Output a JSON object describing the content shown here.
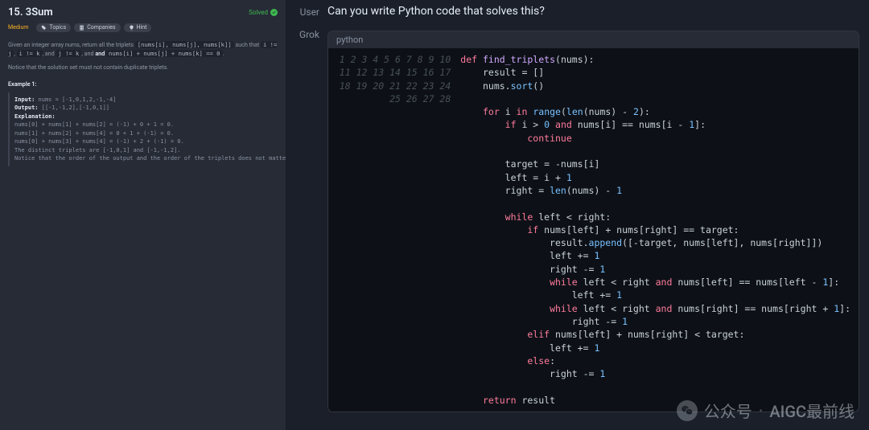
{
  "problem": {
    "title": "15. 3Sum",
    "solved_label": "Solved",
    "difficulty": "Medium",
    "tags": [
      {
        "icon": "tag",
        "label": "Topics"
      },
      {
        "icon": "building",
        "label": "Companies"
      },
      {
        "icon": "lightbulb",
        "label": "Hint"
      }
    ],
    "desc_pre": "Given an integer array nums, return all the triplets ",
    "desc_code1": "[nums[i], nums[j], nums[k]]",
    "desc_mid1": " such that ",
    "desc_code2": "i != j",
    "desc_mid2": ", ",
    "desc_code3": "i != k",
    "desc_mid3": ", and ",
    "desc_code4": "j != k",
    "desc_mid4": ", and ",
    "desc_code5": "nums[i] + nums[j] + nums[k] == 0",
    "desc_post": ".",
    "notice": "Notice that the solution set must not contain duplicate triplets.",
    "example_title": "Example 1:",
    "example": {
      "input_label": "Input:",
      "input": " nums = [-1,0,1,2,-1,-4]",
      "output_label": "Output:",
      "output": " [[-1,-1,2],[-1,0,1]]",
      "explanation_label": "Explanation:",
      "lines": [
        "nums[0] + nums[1] + nums[2] = (-1) + 0 + 1 = 0.",
        "nums[1] + nums[2] + nums[4] = 0 + 1 + (-1) = 0.",
        "nums[0] + nums[3] + nums[4] = (-1) + 2 + (-1) = 0.",
        "The distinct triplets are [-1,0,1] and [-1,-1,2].",
        "Notice that the order of the output and the order of the triplets does not matter."
      ]
    }
  },
  "chat": {
    "user_role": "User",
    "assistant_role": "Grok",
    "user_message": "Can you write Python code that solves this?",
    "code_language": "python",
    "code_lines": [
      "def find_triplets(nums):",
      "    result = []",
      "    nums.sort()",
      "",
      "    for i in range(len(nums) - 2):",
      "        if i > 0 and nums[i] == nums[i - 1]:",
      "            continue",
      "",
      "        target = -nums[i]",
      "        left = i + 1",
      "        right = len(nums) - 1",
      "",
      "        while left < right:",
      "            if nums[left] + nums[right] == target:",
      "                result.append([-target, nums[left], nums[right]])",
      "                left += 1",
      "                right -= 1",
      "                while left < right and nums[left] == nums[left - 1]:",
      "                    left += 1",
      "                while left < right and nums[right] == nums[right + 1]:",
      "                    right -= 1",
      "            elif nums[left] + nums[right] < target:",
      "                left += 1",
      "            else:",
      "                right -= 1",
      "",
      "    return result",
      ""
    ]
  },
  "watermark": {
    "prefix": "公众号",
    "sep": "·",
    "name": "AIGC最前线"
  }
}
